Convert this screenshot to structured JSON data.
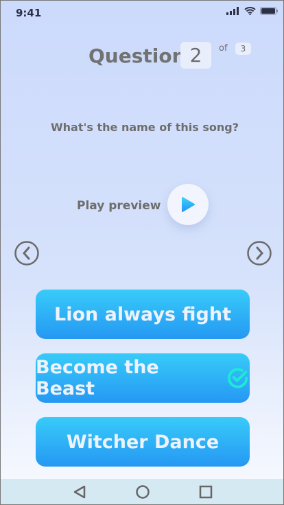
{
  "status_bar": {
    "time": "9:41"
  },
  "header": {
    "label": "Question",
    "current": "2",
    "of": "of",
    "total": "3"
  },
  "question": "What's the name of this song?",
  "preview": {
    "label": "Play preview"
  },
  "answers": [
    {
      "label": "Lion always fight",
      "selected": false
    },
    {
      "label": "Become the Beast",
      "selected": true
    },
    {
      "label": "Witcher Dance",
      "selected": false
    }
  ],
  "colors": {
    "button_top": "#38cbf9",
    "button_bottom": "#2598f3",
    "check": "#1de9d6"
  }
}
